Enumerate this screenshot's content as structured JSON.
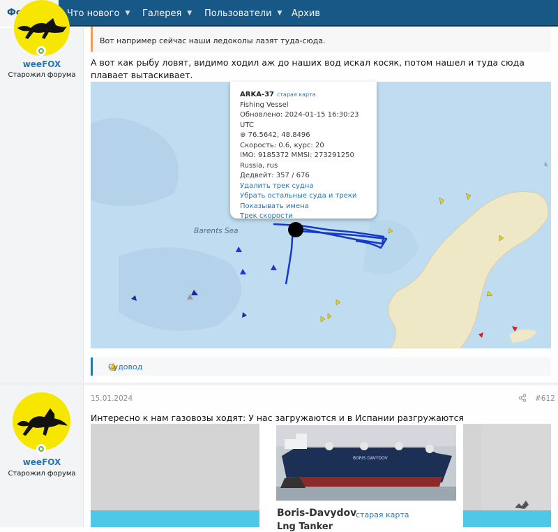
{
  "nav": {
    "forum": "Форум",
    "whats_new": "Что нового",
    "gallery": "Галерея",
    "users": "Пользователи",
    "archive": "Архив"
  },
  "post1": {
    "author": "weeFOX",
    "user_title": "Старожил форума",
    "quote": "Вот например сейчас наши ледоколы лазят туда-сюда.",
    "text": "А вот как рыбу ловят, видимо ходил аж до наших вод искал косяк, потом нашел и туда сюда плавает вытаскивает.",
    "map": {
      "sea_label": "Barents Sea",
      "popup": {
        "name": "ARKA-37",
        "old_map": "старая карта",
        "type": "Fishing Vessel",
        "updated": "Обновлено: 2024-01-15 16:30:23 UTC",
        "coords": "76.5642, 48.8496",
        "speed": "Скорость: 0.6, курс: 20",
        "ids": "IMO: 9185372 MMSI: 273291250",
        "flag": "Russia, rus",
        "deadweight": "Дедвейт: 357 / 676",
        "link_delete": "Удалить трек судна",
        "link_hide": "Убрать остальные суда и треки",
        "link_names": "Показывать имена",
        "link_speed": "Трек скорости"
      }
    },
    "reaction": "Судовод"
  },
  "post2": {
    "date": "15.01.2024",
    "number": "#612",
    "author": "weeFOX",
    "user_title": "Старожил форума",
    "text": "Интересно к нам газовозы ходят: У нас загружаются и в Испании разгружаются",
    "card": {
      "ship_name": "Boris-Davydov",
      "old_map": "старая карта",
      "ship_type": "Lng Tanker",
      "hull_text": "BORIS DAVYDOV"
    }
  },
  "colors": {
    "nav": "#185886",
    "link": "#2577b1",
    "avatar_bg": "#f6e600",
    "sea": "#bfdcf0",
    "land": "#efe8c6",
    "track": "#1538c8"
  }
}
